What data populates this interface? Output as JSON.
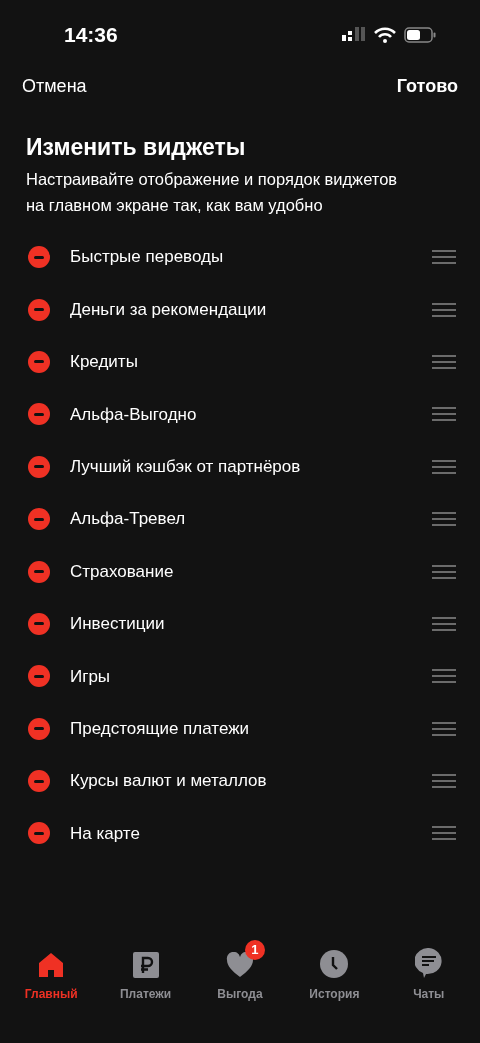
{
  "status_bar": {
    "time": "14:36"
  },
  "nav": {
    "cancel": "Отмена",
    "done": "Готово"
  },
  "title": "Изменить виджеты",
  "description": "Настраивайте отображение и порядок виджетов на главном экране так, как вам удобно",
  "widgets": [
    {
      "label": "Быстрые переводы"
    },
    {
      "label": "Деньги за рекомендации"
    },
    {
      "label": "Кредиты"
    },
    {
      "label": "Альфа-Выгодно"
    },
    {
      "label": "Лучший кэшбэк от партнёров"
    },
    {
      "label": "Альфа-Тревел"
    },
    {
      "label": "Страхование"
    },
    {
      "label": "Инвестиции"
    },
    {
      "label": "Игры"
    },
    {
      "label": "Предстоящие платежи"
    },
    {
      "label": "Курсы валют и металлов"
    },
    {
      "label": "На карте"
    }
  ],
  "tab_bar": [
    {
      "kind": "home",
      "label": "Главный",
      "selected": true
    },
    {
      "kind": "payments",
      "label": "Платежи",
      "selected": false
    },
    {
      "kind": "benefits",
      "label": "Выгода",
      "selected": false,
      "badge": "1"
    },
    {
      "kind": "history",
      "label": "История",
      "selected": false
    },
    {
      "kind": "chats",
      "label": "Чаты",
      "selected": false
    }
  ]
}
